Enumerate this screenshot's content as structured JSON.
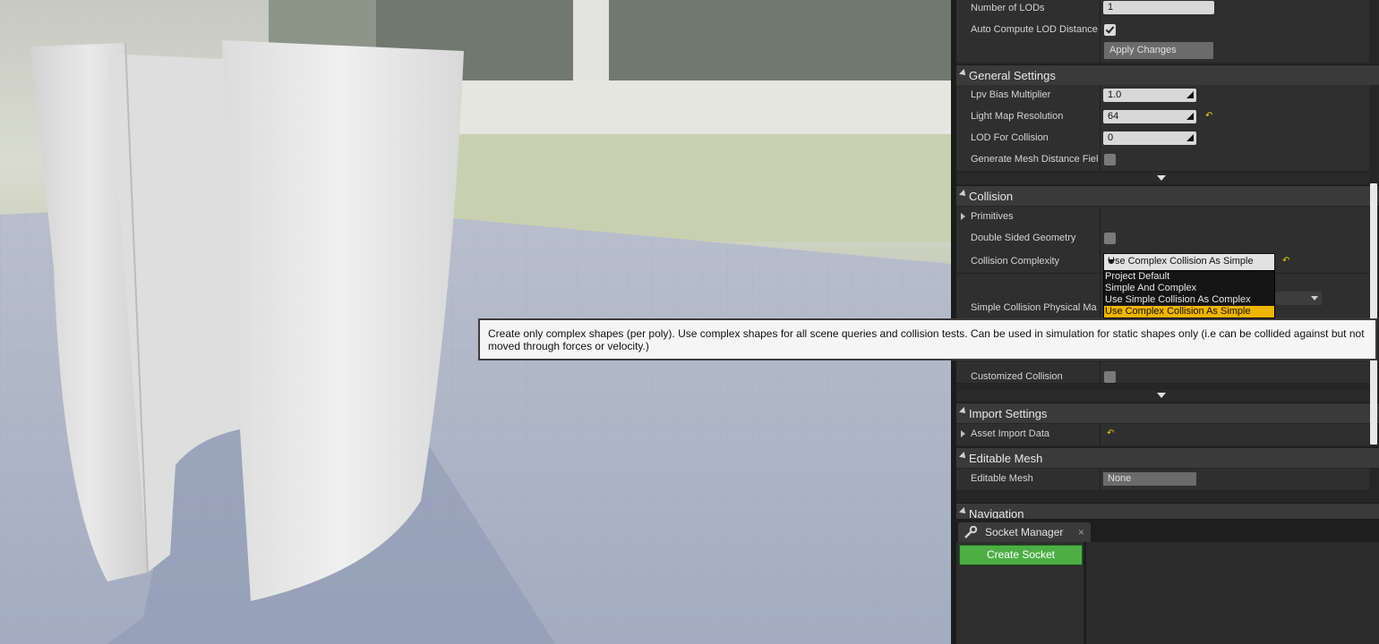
{
  "viewport": {
    "label": "3D viewport - static mesh preview"
  },
  "details": {
    "lod_rows": {
      "number_of_lods": {
        "label": "Number of LODs",
        "value": "1"
      },
      "auto_compute_lod_distance": {
        "label": "Auto Compute LOD Distance",
        "checked": true
      },
      "apply_changes": "Apply Changes"
    },
    "general_settings": {
      "title": "General Settings",
      "lpv_bias_multiplier": {
        "label": "Lpv Bias Multiplier",
        "value": "1.0"
      },
      "light_map_resolution": {
        "label": "Light Map Resolution",
        "value": "64"
      },
      "lod_for_collision": {
        "label": "LOD For Collision",
        "value": "0"
      },
      "generate_mesh_distance_field": {
        "label": "Generate Mesh Distance Fiel",
        "checked": false
      }
    },
    "collision": {
      "title": "Collision",
      "primitives": {
        "label": "Primitives"
      },
      "double_sided_geometry": {
        "label": "Double Sided Geometry",
        "checked": false
      },
      "collision_complexity": {
        "label": "Collision Complexity",
        "value": "Use Complex Collision As Simple"
      },
      "simple_collision_physical_material": {
        "label": "Simple Collision Physical Ma"
      },
      "customized_collision": {
        "label": "Customized Collision",
        "checked": false
      }
    },
    "import_settings": {
      "title": "Import Settings",
      "asset_import_data": {
        "label": "Asset Import Data"
      }
    },
    "editable_mesh": {
      "title": "Editable Mesh",
      "editable_mesh": {
        "label": "Editable Mesh",
        "value": "None"
      }
    },
    "navigation": {
      "title": "Navigation"
    }
  },
  "dropdown": {
    "options": [
      "Project Default",
      "Simple And Complex",
      "Use Simple Collision As Complex",
      "Use Complex Collision As Simple"
    ],
    "selected": "Use Complex Collision As Simple"
  },
  "tooltip": {
    "text": "Create only complex shapes (per poly). Use complex shapes for all scene queries and collision tests. Can be used in simulation for static shapes only (i.e can be collided against but not moved through forces or velocity.)"
  },
  "socket_manager": {
    "tab_title": "Socket Manager",
    "close": "×",
    "create_socket": "Create Socket"
  },
  "colors": {
    "accent_selection": "#f0b500",
    "create_button": "#4caf44",
    "reset_arrow": "#e5d500"
  },
  "icons": {
    "tab_icon": "wrench-icon",
    "reset": "reset-to-default-icon",
    "spin": "drag-spin-icon"
  }
}
